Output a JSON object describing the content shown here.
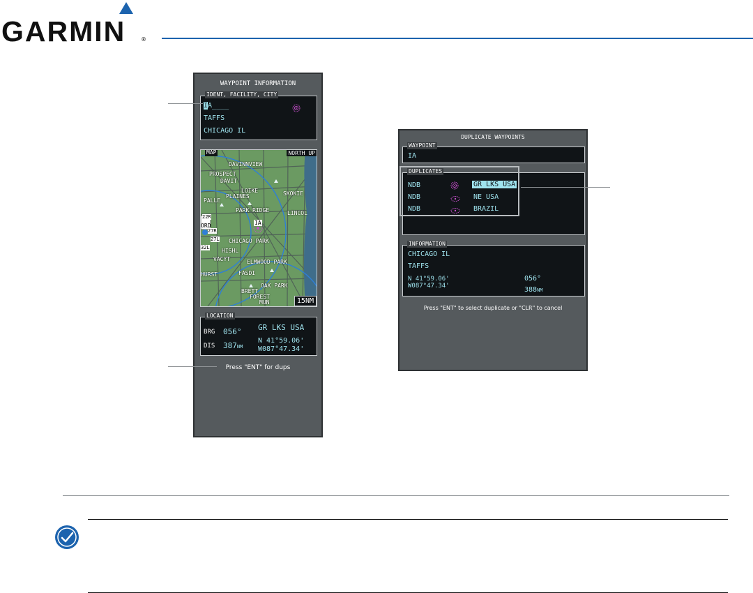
{
  "header": {
    "logo_text": "GARMIN",
    "registered_mark": "®"
  },
  "waypoint_info": {
    "title": "WAYPOINT INFORMATION",
    "ident_box_title": "IDENT, FACILITY, CITY",
    "ident_cursor": "I",
    "ident_rest": "A____",
    "facility": "TAFFS",
    "city": "CHICAGO IL",
    "map_title": "MAP",
    "map_orientation": "NORTH UP",
    "map_range": "15NM",
    "map_labels": [
      "DAVINNVIEW",
      "PROSPECT",
      "DAVIT",
      "LOIKE",
      "SKOKIE",
      "PALLE",
      "PLAINES",
      "PARK RIDGE",
      "LINCOL",
      "IA",
      "CHICAGO PARK",
      "HISHL",
      "VACYT",
      "ELMWOOD PARK",
      "FASDI",
      "OAK PARK",
      "BRETT",
      "FOREST",
      "MUN",
      "ORD",
      "22R",
      "27R",
      "27L",
      "32L",
      "HURST"
    ],
    "location_box_title": "LOCATION",
    "brg_label": "BRG",
    "brg_value": "056°",
    "dis_label": "DIS",
    "dis_value": "387",
    "dis_unit": "NM",
    "region": "GR LKS USA",
    "lat": "N 41°59.06'",
    "lon": "W087°47.34'",
    "prompt": "Press \"ENT\" for dups"
  },
  "duplicate_waypoints": {
    "title": "DUPLICATE WAYPOINTS",
    "waypoint_box_title": "WAYPOINT",
    "waypoint_value": "IA",
    "duplicates_box_title": "DUPLICATES",
    "rows": [
      {
        "type": "NDB",
        "region": "GR LKS USA",
        "selected": true
      },
      {
        "type": "NDB",
        "region": "NE USA",
        "selected": false
      },
      {
        "type": "NDB",
        "region": "BRAZIL",
        "selected": false
      }
    ],
    "info_box_title": "INFORMATION",
    "info_city": "CHICAGO IL",
    "info_facility": "TAFFS",
    "info_lat": "N 41°59.06'",
    "info_lon": "W087°47.34'",
    "info_brg": "056°",
    "info_dis": "388",
    "info_dis_unit": "NM",
    "prompt": "Press \"ENT\" to select duplicate or \"CLR\" to cancel"
  },
  "colors": {
    "brand_blue": "#1c63ae",
    "screen_cyan": "#9fe3ee",
    "ndb_magenta": "#c34fc8",
    "selection_cyan": "#9fe3ee"
  },
  "icons": [
    "garmin-triangle-icon",
    "ndb-icon",
    "note-check-icon"
  ]
}
